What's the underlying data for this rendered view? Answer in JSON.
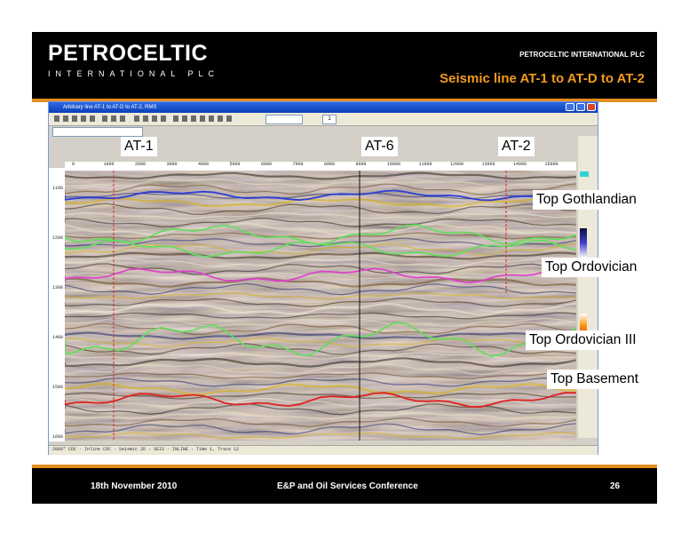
{
  "header": {
    "logo_name": "PETROCELTIC",
    "logo_subtitle": "INTERNATIONAL PLC",
    "company": "PETROCELTIC INTERNATIONAL PLC",
    "title": "Seismic line AT-1 to AT-D to AT-2"
  },
  "window": {
    "title": "Arbitrary line AT-1 to AT-D to AT-2, RMS",
    "status": "2866\" CDC - Inline CDC - Seismic 2D - SEIS - INLINE - Time 1, Trace 12",
    "zoom_value": "1"
  },
  "axis": {
    "x_ticks": [
      "0",
      "1000",
      "2000",
      "3000",
      "4000",
      "5000",
      "6000",
      "7000",
      "8000",
      "9000",
      "10000",
      "11000",
      "12000",
      "13000",
      "14000",
      "15000"
    ],
    "depth_ticks": [
      "1100",
      "1200",
      "1300",
      "1400",
      "1500",
      "1600"
    ]
  },
  "wells": [
    {
      "label": "AT-1"
    },
    {
      "label": "AT-6"
    },
    {
      "label": "AT-2"
    }
  ],
  "horizons": [
    {
      "label": "Top Gothlandian",
      "color": "#2a3dd6"
    },
    {
      "label": "Top Ordovician",
      "color": "#e23bd0"
    },
    {
      "label": "Top Ordovician III",
      "color": "#5fe05a"
    },
    {
      "label": "Top Basement",
      "color": "#e02020"
    }
  ],
  "footer": {
    "date": "18th November 2010",
    "event": "E&P and Oil Services Conference",
    "page": "26"
  },
  "colors": {
    "accent": "#e38c1f",
    "title_orange": "#f39a1e"
  }
}
